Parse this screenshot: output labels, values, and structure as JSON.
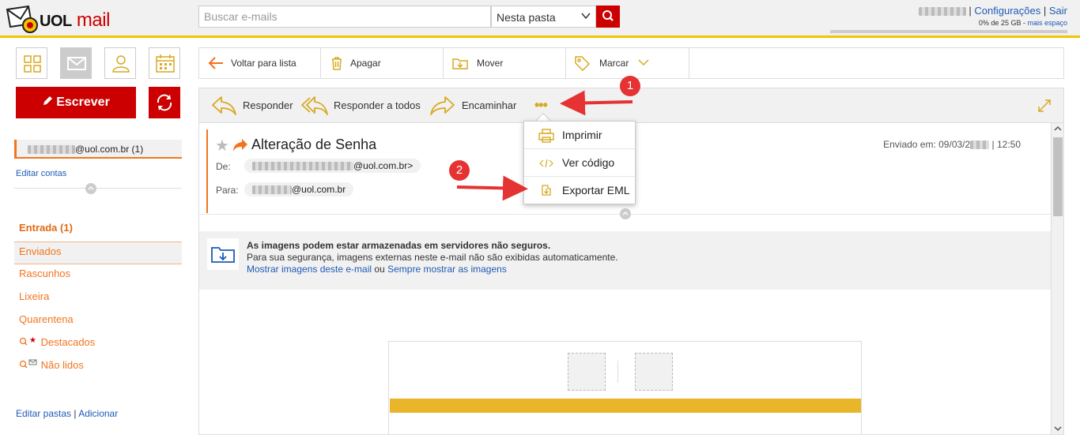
{
  "brand": {
    "logo_text": "UOL",
    "logo_suffix": "mail"
  },
  "search": {
    "placeholder": "Buscar e-mails",
    "scope": "Nesta pasta"
  },
  "user": {
    "settings": "Configurações",
    "logout": "Sair",
    "separator": "|",
    "quota": "0% de 25 GB",
    "quota_sep": " - ",
    "more_space": "mais espaço",
    "quota_percent": 0
  },
  "sidebar": {
    "compose": "Escrever",
    "account": "@uol.com.br (1)",
    "edit_accounts": "Editar contas",
    "folders": [
      {
        "label": "Entrada (1)"
      },
      {
        "label": "Enviados"
      },
      {
        "label": "Rascunhos"
      },
      {
        "label": "Lixeira"
      },
      {
        "label": "Quarentena"
      },
      {
        "label": "Destacados"
      },
      {
        "label": "Não lidos"
      }
    ],
    "edit_folders": "Editar pastas",
    "add": "Adicionar",
    "separator": "|"
  },
  "toolbar": {
    "back": "Voltar para lista",
    "delete": "Apagar",
    "move": "Mover",
    "mark": "Marcar"
  },
  "actions": {
    "reply": "Responder",
    "reply_all": "Responder a todos",
    "forward": "Encaminhar",
    "more": "•••"
  },
  "menu": {
    "print": "Imprimir",
    "view_code": "Ver código",
    "export": "Exportar EML"
  },
  "message": {
    "subject": "Alteração de Senha",
    "sent_label": "Enviado em: 09/03/2",
    "sent_time": "| 12:50",
    "from_label": "De:",
    "from": "@uol.com.br>",
    "to_label": "Para:",
    "to": "@uol.com.br"
  },
  "warning": {
    "title": "As imagens podem estar armazenadas em servidores não seguros.",
    "body": "Para sua segurança, imagens externas neste e-mail não são exibidas automaticamente.",
    "show_link": "Mostrar imagens deste e-mail",
    "or": "ou",
    "always_link": "Sempre mostrar as imagens"
  },
  "annotations": {
    "badge1": "1",
    "badge2": "2"
  },
  "colors": {
    "accent": "#f2741d",
    "brand_red": "#cc0000",
    "gold": "#d9a921",
    "link": "#1f5ab6"
  }
}
